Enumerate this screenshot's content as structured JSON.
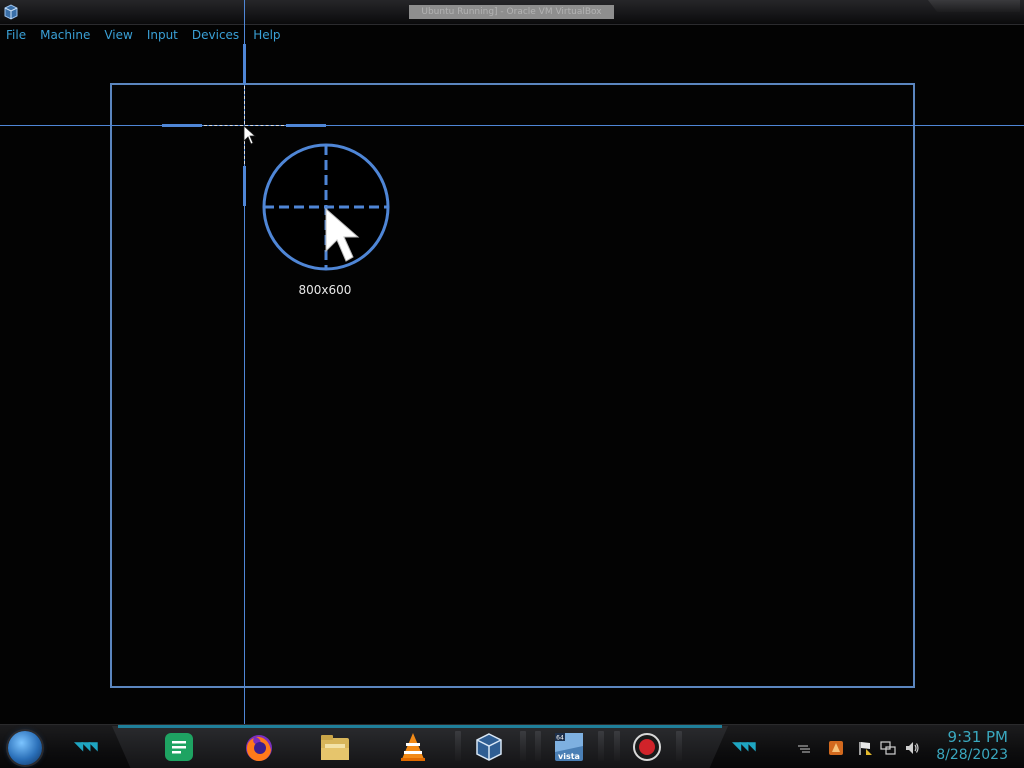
{
  "window": {
    "title": "Ubuntu Running] - Oracle VM VirtualBox"
  },
  "menu": {
    "items": [
      {
        "label": "File"
      },
      {
        "label": "Machine"
      },
      {
        "label": "View"
      },
      {
        "label": "Input"
      },
      {
        "label": "Devices"
      },
      {
        "label": "Help"
      }
    ]
  },
  "capture": {
    "size_label": "800x600",
    "accent_color": "#5b86bf"
  },
  "taskbar": {
    "apps": [
      {
        "name": "google-docs-icon"
      },
      {
        "name": "firefox-icon"
      },
      {
        "name": "file-manager-icon"
      },
      {
        "name": "vlc-icon"
      },
      {
        "name": "virtualbox-icon"
      },
      {
        "name": "vista-icon",
        "label": "vista"
      },
      {
        "name": "screen-recorder-icon"
      }
    ],
    "tray": [
      {
        "name": "app-tray-icon"
      },
      {
        "name": "action-center-flag-icon"
      },
      {
        "name": "network-icon"
      },
      {
        "name": "volume-icon"
      }
    ],
    "clock": {
      "time": "9:31 PM",
      "date": "8/28/2023"
    },
    "accent_color": "#3aa8bf"
  }
}
